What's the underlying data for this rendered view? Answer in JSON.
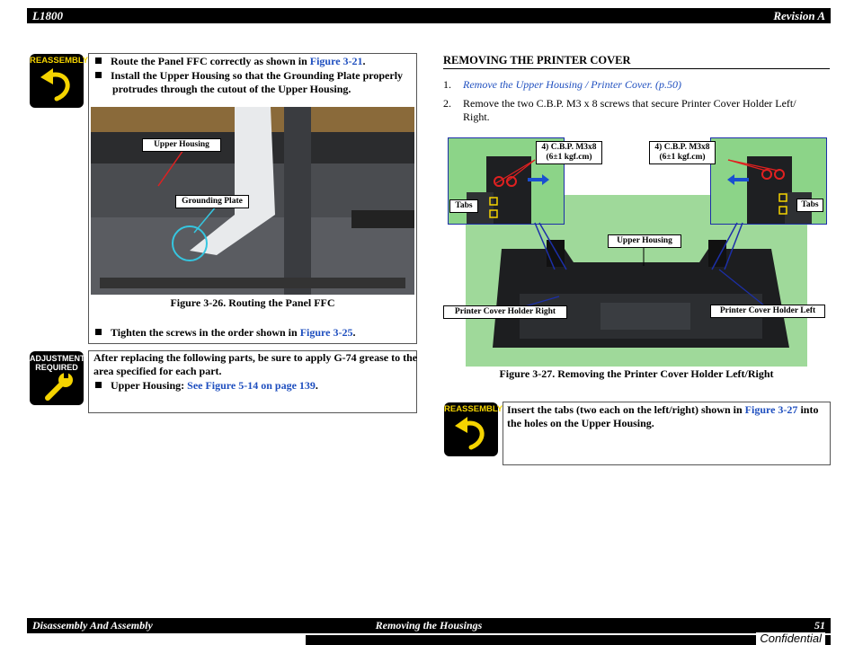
{
  "header": {
    "model": "L1800",
    "revision": "Revision A"
  },
  "footer": {
    "chapter": "Disassembly And Assembly",
    "section": "Removing the Housings",
    "page": "51",
    "confidential": "Confidential"
  },
  "badges": {
    "reassembly": "REASSEMBLY",
    "adjustment_line1": "ADJUSTMENT",
    "adjustment_line2": "REQUIRED"
  },
  "left": {
    "reassembly_box": {
      "b1_text": "Route the Panel FFC correctly as shown in ",
      "b1_link": "Figure 3-21",
      "b1_end": ".",
      "b2_line1": "Install the Upper Housing so that the Grounding Plate properly",
      "b2_line2": "protrudes through the cutout of the Upper Housing.",
      "figure_caption": "Figure 3-26. Routing the Panel FFC",
      "callout_upper": "Upper Housing",
      "callout_ground": "Grounding Plate",
      "b3_text": "Tighten the screws in the order shown in ",
      "b3_link": "Figure 3-25",
      "b3_end": "."
    },
    "adjust_box": {
      "line1": "After replacing the following parts, be sure to apply G-74 grease to the",
      "line2": "area specified for each part.",
      "bullet_text": "Upper Housing: ",
      "bullet_link": "See Figure 5-14 on page 139",
      "bullet_end": "."
    }
  },
  "right": {
    "section_title": "REMOVING THE PRINTER COVER",
    "step1_num": "1.",
    "step1_link": "Remove the Upper Housing / Printer Cover. (p.50)",
    "step2_num": "2.",
    "step2_line1": "Remove the two C.B.P. M3 x 8 screws that secure Printer Cover Holder Left/",
    "step2_line2": "Right.",
    "figure": {
      "screw_left_l1": "4) C.B.P. M3x8",
      "screw_left_l2": "(6±1 kgf.cm)",
      "screw_right_l1": "4) C.B.P. M3x8",
      "screw_right_l2": "(6±1 kgf.cm)",
      "tabs_left": "Tabs",
      "tabs_right": "Tabs",
      "upper_housing": "Upper Housing",
      "holder_right": "Printer Cover Holder Right",
      "holder_left": "Printer Cover Holder Left",
      "caption": "Figure 3-27. Removing the Printer Cover Holder Left/Right"
    },
    "reassembly_note": {
      "line1_text": "Insert the tabs (two each on the left/right) shown in ",
      "line1_link": "Figure 3-27",
      "line1_end": " into",
      "line2": "the holes on the Upper Housing."
    }
  }
}
